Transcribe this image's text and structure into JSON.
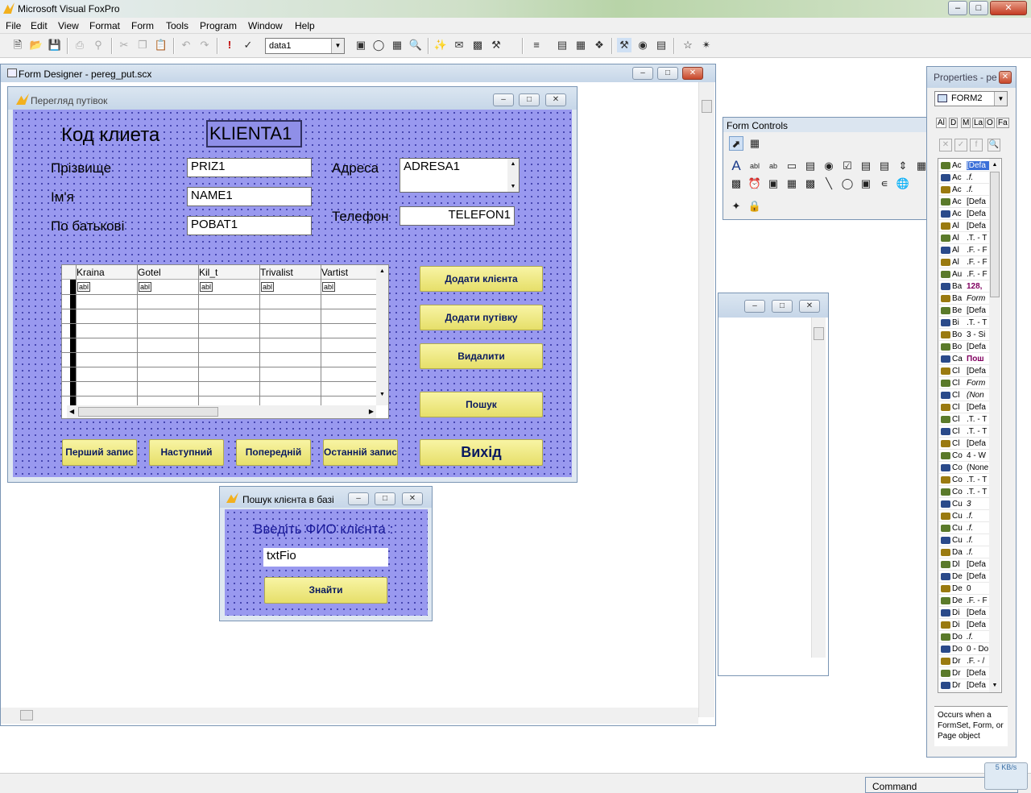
{
  "app": {
    "title": "Microsoft Visual FoxPro"
  },
  "menu": [
    "File",
    "Edit",
    "View",
    "Format",
    "Form",
    "Tools",
    "Program",
    "Window",
    "Help"
  ],
  "toolbar": {
    "datasession": "data1"
  },
  "form_designer": {
    "title": "Form Designer - pereg_put.scx"
  },
  "form_main": {
    "title": "Перегляд путівок",
    "code_label": "Код клиета",
    "code_value": "KLIENTA1",
    "surname_label": "Прізвище",
    "surname_value": "PRIZ1",
    "name_label": "Ім'я",
    "name_value": "NAME1",
    "patronymic_label": "По батькові",
    "patronymic_value": "POBAT1",
    "address_label": "Адреса",
    "address_value": "ADRESA1",
    "phone_label": "Телефон",
    "phone_value": "TELEFON1",
    "grid": {
      "columns": [
        "Kraina",
        "Gotel",
        "Kil_t",
        "Trivalist",
        "Vartist"
      ],
      "cell_marker": "abl"
    },
    "buttons": {
      "add_client": "Додати клієнта",
      "add_voucher": "Додати путівку",
      "delete": "Видалити",
      "search": "Пошук",
      "exit": "Вихід",
      "first": "Перший запис",
      "next": "Наступний",
      "prev": "Попередній",
      "last": "Останній запис"
    }
  },
  "search_form": {
    "title": "Пошук клієнта в базі",
    "prompt": "Введіть ФИО клієнта :",
    "input_value": "txtFio",
    "find_button": "Знайти"
  },
  "form_controls": {
    "title": "Form Controls"
  },
  "properties": {
    "title": "Properties - pe",
    "object": "FORM2",
    "tabs": [
      "Al",
      "D",
      "M",
      "La",
      "O",
      "Fa"
    ],
    "rows": [
      {
        "n": "Ac",
        "v": "[Defa"
      },
      {
        "n": "Ac",
        "v": ".f."
      },
      {
        "n": "Ac",
        "v": ".f."
      },
      {
        "n": "Ac",
        "v": "[Defa"
      },
      {
        "n": "Ac",
        "v": "[Defa"
      },
      {
        "n": "Al",
        "v": "[Defa"
      },
      {
        "n": "Al",
        "v": ".T. - T"
      },
      {
        "n": "Al",
        "v": ".F. - F"
      },
      {
        "n": "Al",
        "v": ".F. - F"
      },
      {
        "n": "Au",
        "v": ".F. - F"
      },
      {
        "n": "Ba",
        "v": "128,"
      },
      {
        "n": "Ba",
        "v": "Form"
      },
      {
        "n": "Be",
        "v": "[Defa"
      },
      {
        "n": "Bi",
        "v": ".T. - T"
      },
      {
        "n": "Bo",
        "v": "3 - Si"
      },
      {
        "n": "Bo",
        "v": "[Defa"
      },
      {
        "n": "Ca",
        "v": "Пош"
      },
      {
        "n": "Cl",
        "v": "[Defa"
      },
      {
        "n": "Cl",
        "v": "Form"
      },
      {
        "n": "Cl",
        "v": "(Non"
      },
      {
        "n": "Cl",
        "v": "[Defa"
      },
      {
        "n": "Cl",
        "v": ".T. - T"
      },
      {
        "n": "Cl",
        "v": ".T. - T"
      },
      {
        "n": "Cl",
        "v": "[Defa"
      },
      {
        "n": "Co",
        "v": "4 - W"
      },
      {
        "n": "Co",
        "v": "(None"
      },
      {
        "n": "Co",
        "v": ".T. - T"
      },
      {
        "n": "Co",
        "v": ".T. - T"
      },
      {
        "n": "Cu",
        "v": "3"
      },
      {
        "n": "Cu",
        "v": ".f."
      },
      {
        "n": "Cu",
        "v": ".f."
      },
      {
        "n": "Cu",
        "v": ".f."
      },
      {
        "n": "Da",
        "v": ".f."
      },
      {
        "n": "Dl",
        "v": "[Defa"
      },
      {
        "n": "De",
        "v": "[Defa"
      },
      {
        "n": "De",
        "v": "0"
      },
      {
        "n": "De",
        "v": ".F. - F"
      },
      {
        "n": "Di",
        "v": "[Defa"
      },
      {
        "n": "Di",
        "v": "[Defa"
      },
      {
        "n": "Do",
        "v": ".f."
      },
      {
        "n": "Do",
        "v": "0 - Do"
      },
      {
        "n": "Dr",
        "v": ".F. - /"
      },
      {
        "n": "Dr",
        "v": "[Defa"
      },
      {
        "n": "Dr",
        "v": "[Defa"
      }
    ],
    "description": "Occurs when a FormSet, Form, or Page object"
  },
  "command_window": {
    "title": "Command"
  },
  "tray": {
    "net": "5 KB/s"
  }
}
